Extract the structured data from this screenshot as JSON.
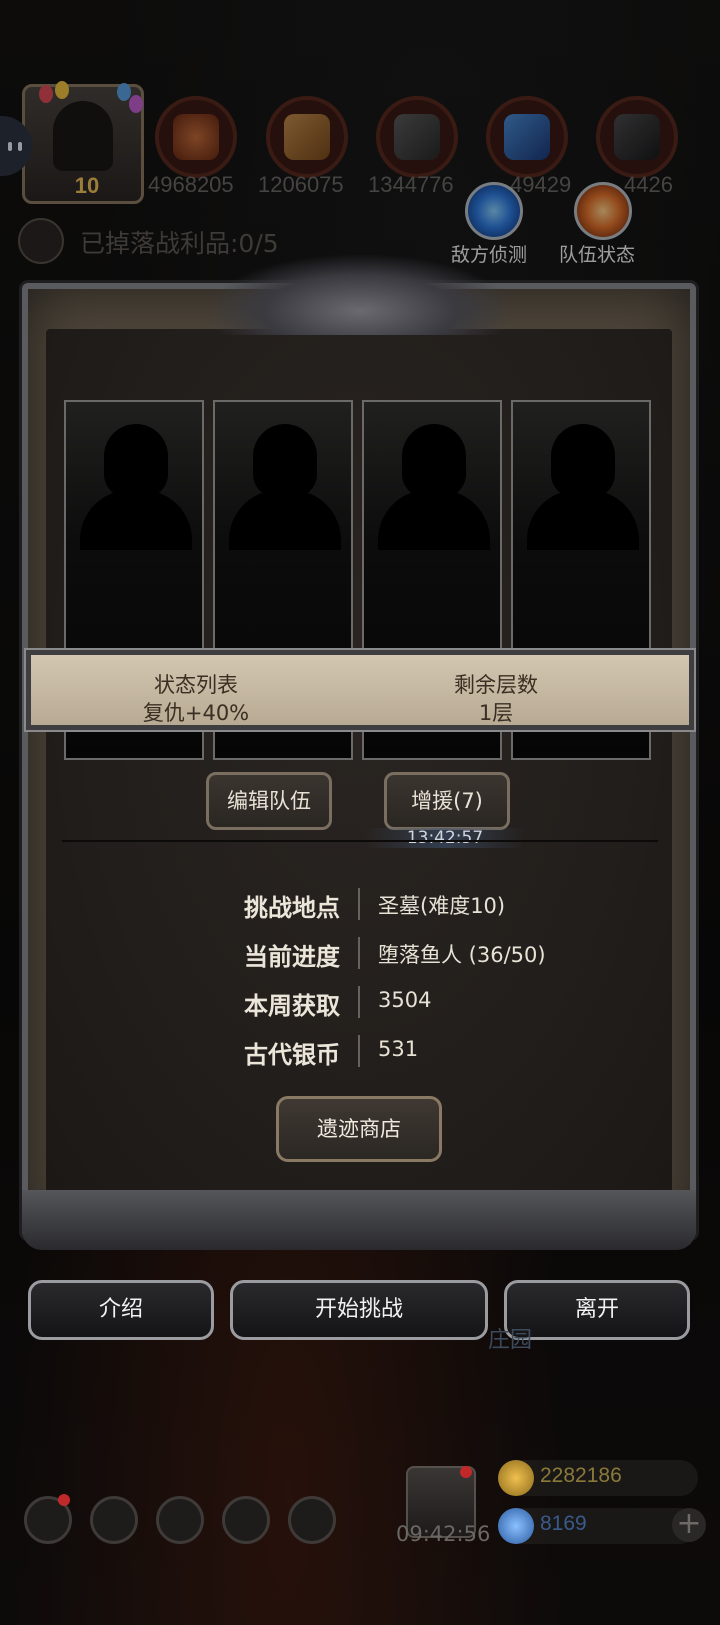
{
  "resources": [
    {
      "icon": "meat-icon",
      "value": "4968205"
    },
    {
      "icon": "wood-icon",
      "value": "1206075"
    },
    {
      "icon": "stone-icon",
      "value": "1344776"
    },
    {
      "icon": "crystal-icon",
      "value": "49429"
    },
    {
      "icon": "iron-icon",
      "value": "4426"
    }
  ],
  "avatar": {
    "level": "10"
  },
  "quick_actions": {
    "enemy_scout": "敌方侦测",
    "team_status": "队伍状态"
  },
  "loot": {
    "label": "已掉落战利品:0/5"
  },
  "status_table": {
    "header_left": "状态列表",
    "header_right": "剩余层数",
    "value_left": "复仇+40%",
    "value_right": "1层"
  },
  "team_buttons": {
    "edit": "编辑队伍",
    "reinforce": "增援(7)",
    "reinforce_timer": "13:42:57"
  },
  "info": [
    {
      "key": "挑战地点",
      "value": "圣墓(难度10)"
    },
    {
      "key": "当前进度",
      "value": "堕落鱼人 (36/50)"
    },
    {
      "key": "本周获取",
      "value": "3504"
    },
    {
      "key": "古代银币",
      "value": "531"
    }
  ],
  "shop_button": "遗迹商店",
  "actions": {
    "intro": "介绍",
    "start": "开始挑战",
    "leave": "离开"
  },
  "background_label": "庄园",
  "bottom": {
    "gift_timer": "09:42:56",
    "gold": "2282186",
    "gems": "8169"
  },
  "colors": {
    "gold_text": "#8a7a3a",
    "gem_text": "#3a5a8a",
    "accent_blue": "#2f7be0",
    "accent_orange": "#e0702a"
  }
}
